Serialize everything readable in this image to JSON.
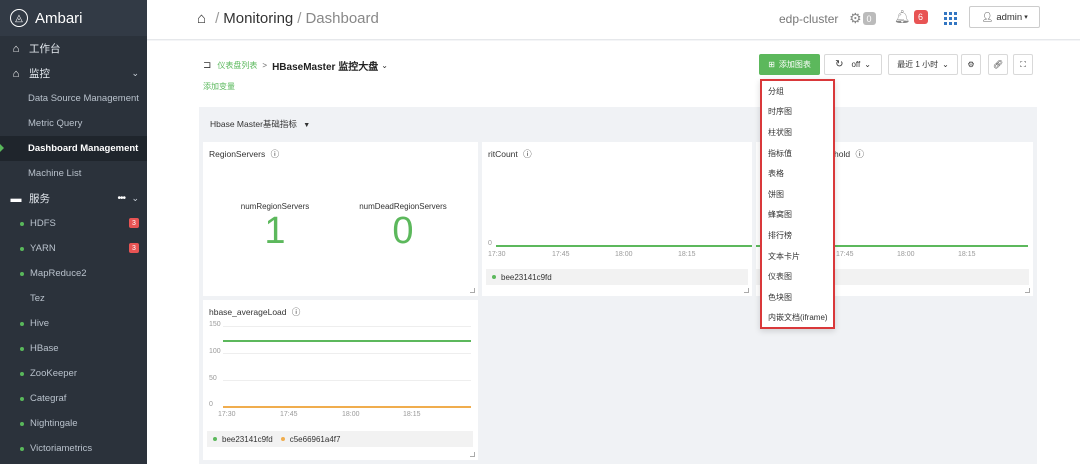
{
  "sidebar": {
    "brand": "Ambari",
    "workbench": "工作台",
    "monitor": "监控",
    "monitor_items": [
      "Data Source Management",
      "Metric Query",
      "Dashboard Management",
      "Machine List"
    ],
    "services_label": "服务",
    "services": [
      {
        "name": "HDFS",
        "badge": "3"
      },
      {
        "name": "YARN",
        "badge": "3"
      },
      {
        "name": "MapReduce2",
        "badge": ""
      },
      {
        "name": "Tez",
        "badge": ""
      },
      {
        "name": "Hive",
        "badge": ""
      },
      {
        "name": "HBase",
        "badge": ""
      },
      {
        "name": "ZooKeeper",
        "badge": ""
      },
      {
        "name": "Categraf",
        "badge": ""
      },
      {
        "name": "Nightingale",
        "badge": ""
      },
      {
        "name": "Victoriametrics",
        "badge": ""
      }
    ]
  },
  "header": {
    "breadcrumb_root": "Monitoring",
    "breadcrumb_current": "Dashboard",
    "cluster": "edp-cluster",
    "ops_count": "0",
    "alerts_count": "6",
    "user": "admin"
  },
  "toolbar": {
    "back_link": "仪表盘列表",
    "dashboard_title": "HBaseMaster 监控大盘",
    "add_variable": "添加变量",
    "add_chart": "添加图表",
    "refresh": "off",
    "time_range": "最近 1 小时"
  },
  "group": {
    "title": "Hbase Master基础指标"
  },
  "panels": {
    "regionservers": {
      "title": "RegionServers",
      "stat1_label": "numRegionServers",
      "stat1_value": "1",
      "stat2_label": "numDeadRegionServers",
      "stat2_value": "0"
    },
    "ritcount": {
      "title": "ritCount",
      "y0": "0",
      "x_ticks": [
        "17:30",
        "17:45",
        "18:00",
        "18:15"
      ],
      "legend": "bee23141c9fd"
    },
    "threshold": {
      "title": "hold",
      "x_ticks": [
        "17:45",
        "18:00",
        "18:15"
      ]
    },
    "averageload": {
      "title": "hbase_averageLoad",
      "y_ticks": [
        "150",
        "100",
        "50",
        "0"
      ],
      "x_ticks": [
        "17:30",
        "17:45",
        "18:00",
        "18:15"
      ],
      "legend1": "bee23141c9fd",
      "legend2": "c5e66961a4f7"
    }
  },
  "dropdown": {
    "items": [
      "分组",
      "时序图",
      "柱状图",
      "指标值",
      "表格",
      "饼图",
      "蜂窝图",
      "排行榜",
      "文本卡片",
      "仪表图",
      "色块图",
      "内嵌文档(iframe)"
    ]
  },
  "colors": {
    "accent": "#5cb85c",
    "sidebar": "#2b323b",
    "alert": "#e85454",
    "series2": "#f0ad4e"
  }
}
